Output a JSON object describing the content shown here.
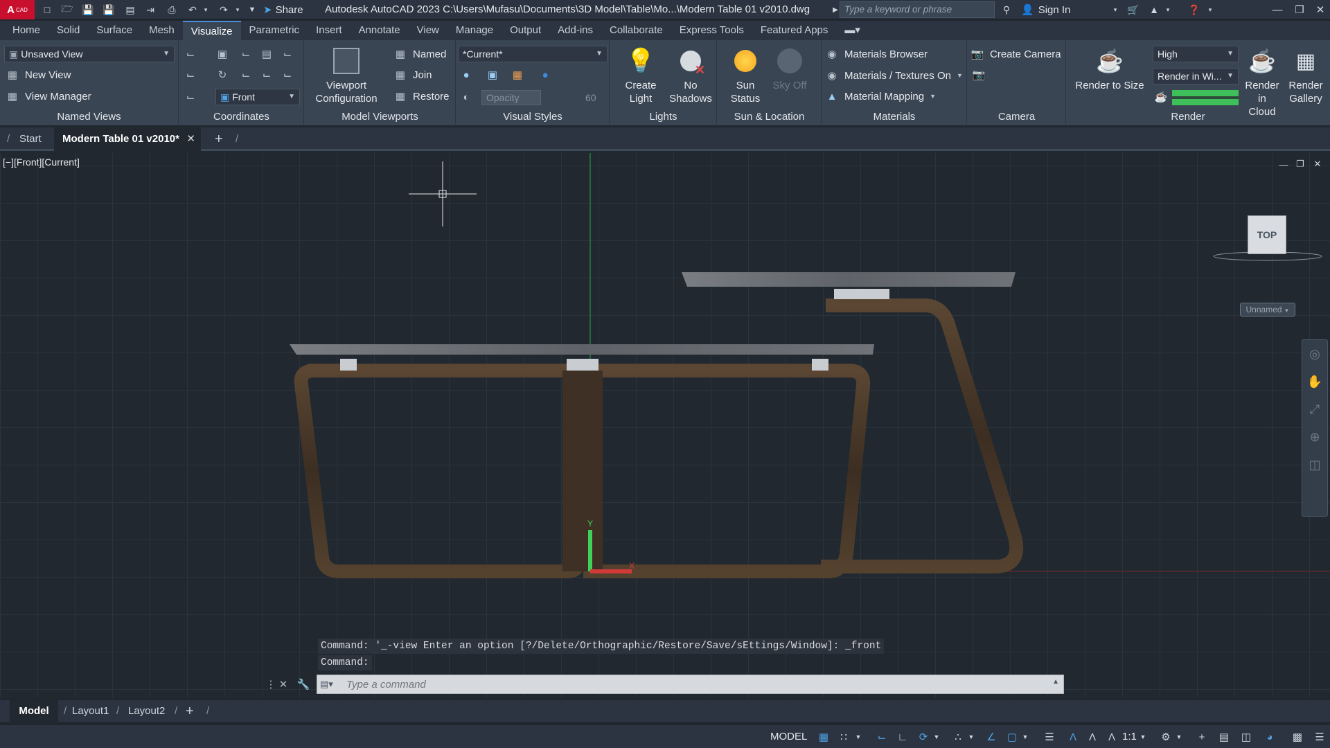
{
  "app": {
    "logo_text": "A",
    "logo_sub": "CAD",
    "share": "Share",
    "title": "Autodesk AutoCAD 2023   C:\\Users\\Mufasu\\Documents\\3D Model\\Table\\Mo...\\Modern Table 01 v2010.dwg",
    "search_placeholder": "Type a keyword or phrase",
    "sign_in": "Sign In"
  },
  "ribbon_tabs": [
    "Home",
    "Solid",
    "Surface",
    "Mesh",
    "Visualize",
    "Parametric",
    "Insert",
    "Annotate",
    "View",
    "Manage",
    "Output",
    "Add-ins",
    "Collaborate",
    "Express Tools",
    "Featured Apps"
  ],
  "active_tab": "Visualize",
  "panels": {
    "named_views": {
      "title": "Named Views",
      "view_select": "Unsaved View",
      "new_view": "New View",
      "view_manager": "View Manager"
    },
    "coordinates": {
      "title": "Coordinates",
      "ucs_select": "Front"
    },
    "model_viewports": {
      "title": "Model Viewports",
      "viewport_config_line1": "Viewport",
      "viewport_config_line2": "Configuration",
      "named": "Named",
      "join": "Join",
      "restore": "Restore"
    },
    "visual_styles": {
      "title": "Visual Styles",
      "style_select": "*Current*",
      "opacity_label": "Opacity",
      "opacity_value": "60"
    },
    "lights": {
      "title": "Lights",
      "create_light_1": "Create",
      "create_light_2": "Light",
      "no_shadows_1": "No",
      "no_shadows_2": "Shadows"
    },
    "sun_location": {
      "title": "Sun & Location",
      "sun_status_1": "Sun",
      "sun_status_2": "Status",
      "sky_off": "Sky Off"
    },
    "materials": {
      "title": "Materials",
      "browser": "Materials Browser",
      "textures": "Materials / Textures On",
      "mapping": "Material Mapping"
    },
    "camera": {
      "title": "Camera",
      "create_camera": "Create Camera"
    },
    "render": {
      "title": "Render",
      "render_to_size": "Render to Size",
      "quality": "High",
      "render_in": "Render in Wi...",
      "cloud_1": "Render in",
      "cloud_2": "Cloud",
      "gallery_1": "Render",
      "gallery_2": "Gallery"
    }
  },
  "doc_tabs": {
    "start": "Start",
    "active_doc": "Modern Table 01 v2010*",
    "new_tab": "+"
  },
  "viewport": {
    "label": "[−][Front][Current]",
    "viewcube_face": "TOP",
    "ucs_name": "Unnamed"
  },
  "command": {
    "history_1": "Command: '_-view Enter an option [?/Delete/Orthographic/Restore/Save/sEttings/Window]: _front",
    "history_2": "Command:",
    "placeholder": "Type a command"
  },
  "layout_tabs": [
    "Model",
    "Layout1",
    "Layout2"
  ],
  "status": {
    "space": "MODEL",
    "annotation_scale": "1:1"
  },
  "colors": {
    "accent": "#4a90d9",
    "x_axis": "#c0392b",
    "y_axis": "#2ecc71",
    "wood": "#4a3a2a"
  }
}
